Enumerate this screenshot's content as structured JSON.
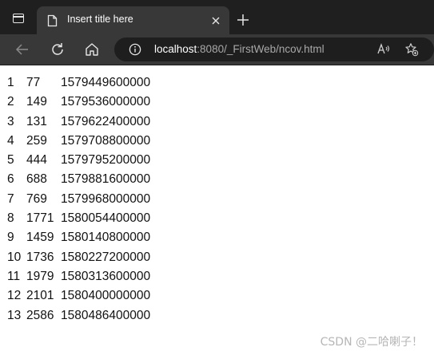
{
  "tab": {
    "title": "Insert title here"
  },
  "address_bar": {
    "host": "localhost",
    "rest": ":8080/_FirstWeb/ncov.html"
  },
  "table": {
    "rows": [
      [
        "1",
        "77",
        "1579449600000"
      ],
      [
        "2",
        "149",
        "1579536000000"
      ],
      [
        "3",
        "131",
        "1579622400000"
      ],
      [
        "4",
        "259",
        "1579708800000"
      ],
      [
        "5",
        "444",
        "1579795200000"
      ],
      [
        "6",
        "688",
        "1579881600000"
      ],
      [
        "7",
        "769",
        "1579968000000"
      ],
      [
        "8",
        "1771",
        "1580054400000"
      ],
      [
        "9",
        "1459",
        "1580140800000"
      ],
      [
        "10",
        "1736",
        "1580227200000"
      ],
      [
        "11",
        "1979",
        "1580313600000"
      ],
      [
        "12",
        "2101",
        "1580400000000"
      ],
      [
        "13",
        "2586",
        "1580486400000"
      ]
    ]
  },
  "watermark": "CSDN @二哈喇子！",
  "icons": {
    "window": "window-icon",
    "page": "page-icon",
    "close": "close-icon",
    "new_tab": "plus-icon",
    "back": "back-arrow-icon",
    "reload": "reload-icon",
    "home": "home-icon",
    "info": "info-icon",
    "read_aloud": "read-aloud-icon",
    "favorites": "add-favorite-icon"
  }
}
